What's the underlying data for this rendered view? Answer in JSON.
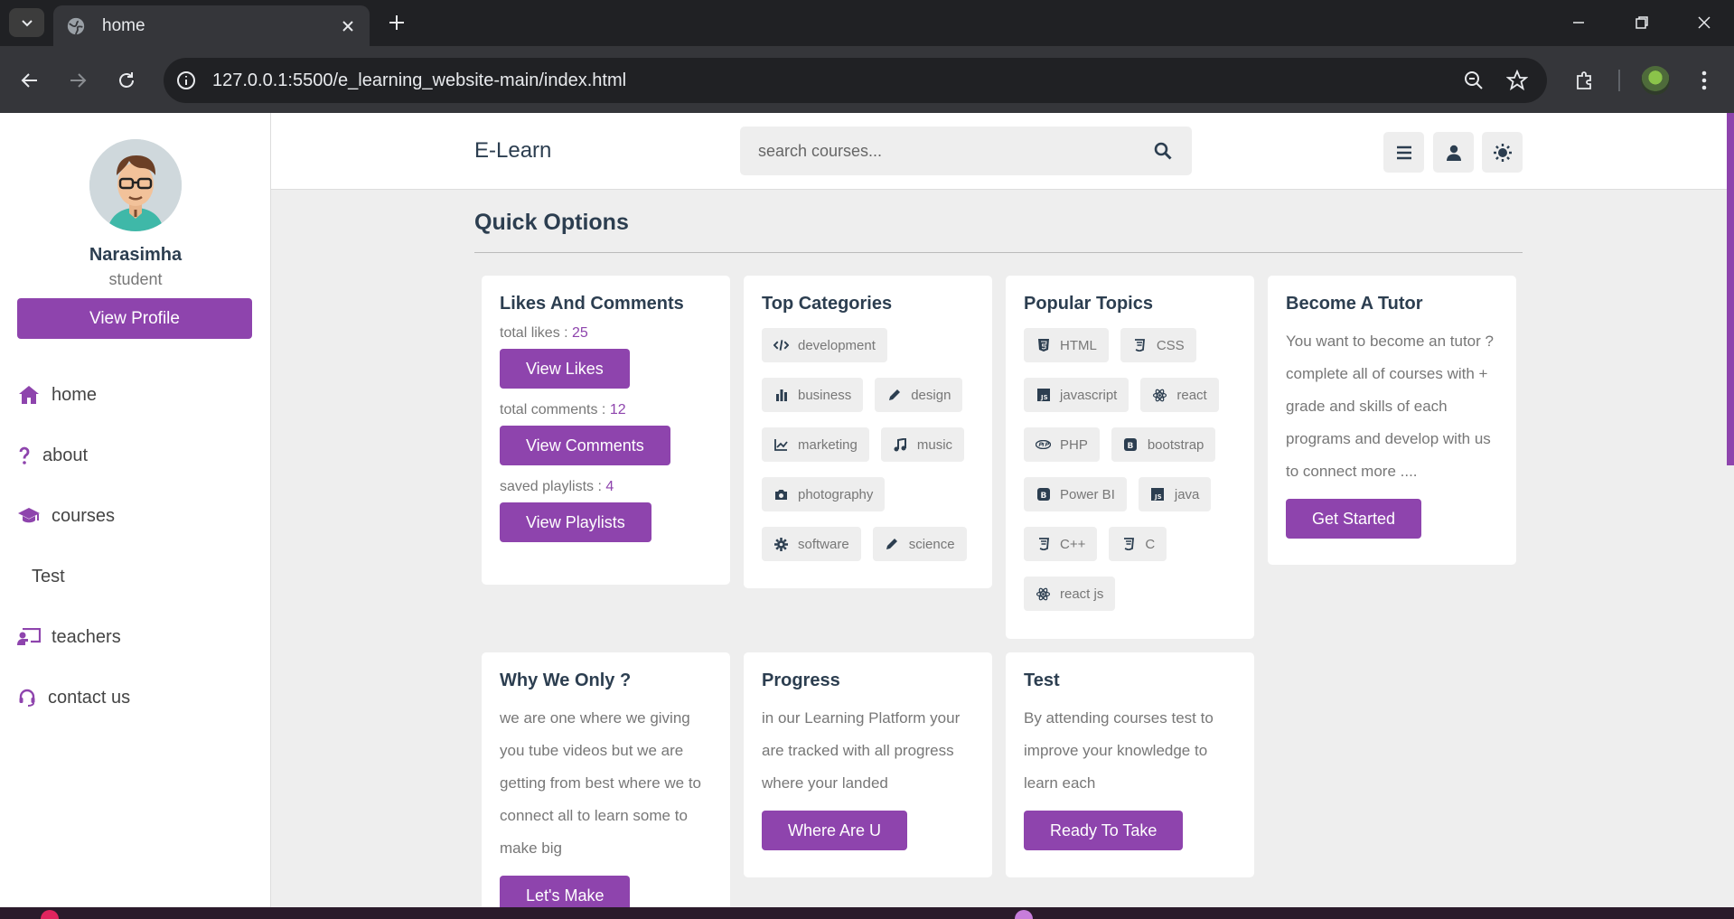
{
  "browser": {
    "tab_title": "home",
    "url": "127.0.0.1:5500/e_learning_website-main/index.html"
  },
  "sidebar": {
    "user_name": "Narasimha",
    "user_role": "student",
    "profile_button": "View Profile",
    "nav": [
      {
        "label": "home",
        "icon": "home-icon"
      },
      {
        "label": "about",
        "icon": "question-icon"
      },
      {
        "label": "courses",
        "icon": "graduation-cap-icon"
      },
      {
        "label": "Test",
        "icon": ""
      },
      {
        "label": "teachers",
        "icon": "chalkboard-teacher-icon"
      },
      {
        "label": "contact us",
        "icon": "headset-icon"
      }
    ]
  },
  "header": {
    "logo": "E-Learn",
    "search_placeholder": "search courses..."
  },
  "main": {
    "heading": "Quick Options",
    "likes_card": {
      "title": "Likes And Comments",
      "likes_label": "total likes : ",
      "likes_value": "25",
      "likes_button": "View Likes",
      "comments_label": "total comments : ",
      "comments_value": "12",
      "comments_button": "View Comments",
      "playlists_label": "saved playlists : ",
      "playlists_value": "4",
      "playlists_button": "View Playlists"
    },
    "categories_card": {
      "title": "Top Categories",
      "tags": [
        "development",
        "business",
        "design",
        "marketing",
        "music",
        "photography",
        "software",
        "science"
      ]
    },
    "topics_card": {
      "title": "Popular Topics",
      "tags": [
        "HTML",
        "CSS",
        "javascript",
        "react",
        "PHP",
        "bootstrap",
        "Power BI",
        "java",
        "C++",
        "C",
        "react js"
      ]
    },
    "tutor_card": {
      "title": "Become A Tutor",
      "text": "You want to become an tutor ? complete all of courses with + grade and skills of each programs and develop with us to connect more ....",
      "button": "Get Started"
    },
    "why_card": {
      "title": "Why We Only ?",
      "text": "we are one where we giving you tube videos but we are getting from best where we to connect all to learn some to make big",
      "button": "Let's Make"
    },
    "progress_card": {
      "title": "Progress",
      "text": "in our Learning Platform your are tracked with all progress where your landed",
      "button": "Where Are U"
    },
    "test_card": {
      "title": "Test",
      "text": "By attending courses test to improve your knowledge to learn each",
      "button": "Ready To Take"
    }
  },
  "colors": {
    "accent": "#8e44ad",
    "heading": "#2c3e50",
    "background": "#eeeeee"
  }
}
